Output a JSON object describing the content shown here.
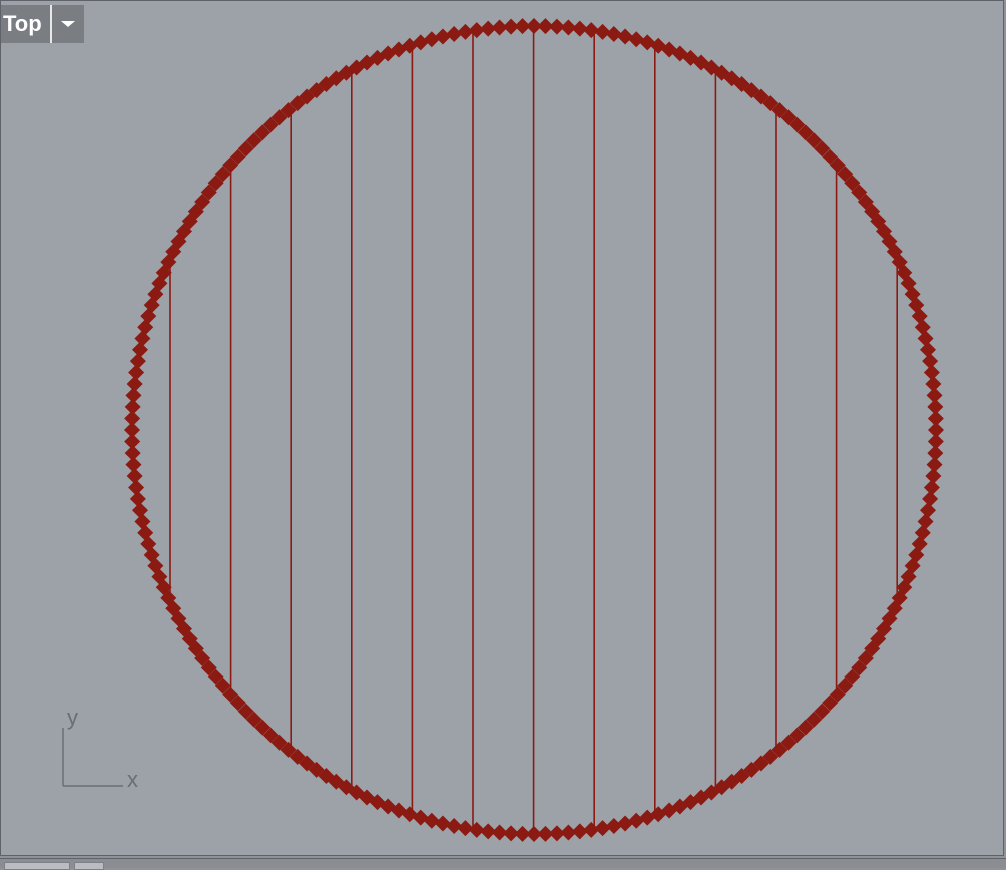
{
  "viewport": {
    "name": "Top",
    "menu_icon": "chevron-down-icon",
    "background": "#9da1a8"
  },
  "axes": {
    "y_label": "y",
    "x_label": "x",
    "color": "#6b6e73"
  },
  "geometry": {
    "curve_color": "#8b1a12",
    "hatch_line_count": 13,
    "boundary_marker": "diamond"
  }
}
